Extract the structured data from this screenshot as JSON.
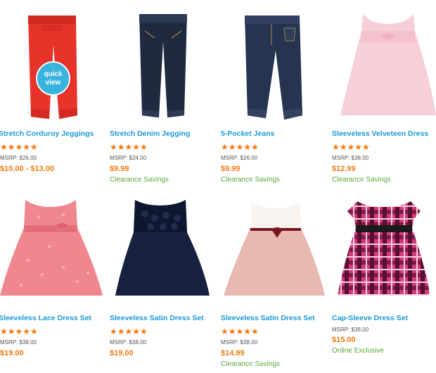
{
  "colors": {
    "link": "#1a9ad6",
    "price": "#f07a10",
    "note": "#59a83a",
    "stars": "#f07a10"
  },
  "quick_view": {
    "line1": "quick",
    "line2": "view"
  },
  "products": [
    {
      "title": "Stretch Corduroy Jeggings",
      "rating": 4.5,
      "stars": "★★★★★",
      "msrp": "MSRP: $26.00",
      "price": "$10.00 - $13.00",
      "note": "",
      "image": "red-jeggings"
    },
    {
      "title": "Stretch Denim Jegging",
      "rating": 5,
      "stars": "★★★★★",
      "msrp": "MSRP: $24.00",
      "price": "$9.99",
      "note": "Clearance Savings",
      "image": "denim-jegging"
    },
    {
      "title": "5-Pocket Jeans",
      "rating": 4.5,
      "stars": "★★★★★",
      "msrp": "MSRP: $26.00",
      "price": "$9.99",
      "note": "Clearance Savings",
      "image": "jeans"
    },
    {
      "title": "Sleeveless Velveteen Dress",
      "rating": 5,
      "stars": "★★★★★",
      "msrp": "MSRP: $38.00",
      "price": "$12.99",
      "note": "Clearance Savings",
      "image": "pink-velveteen-dress"
    },
    {
      "title": "Sleeveless Lace Dress Set",
      "rating": 5,
      "stars": "★★★★★",
      "msrp": "MSRP: $38.00",
      "price": "$19.00",
      "note": "",
      "image": "pink-lace-dress"
    },
    {
      "title": "Sleeveless Satin Dress Set",
      "rating": 5,
      "stars": "★★★★★",
      "msrp": "MSRP: $38.00",
      "price": "$19.00",
      "note": "",
      "image": "navy-satin-dress"
    },
    {
      "title": "Sleeveless Satin Dress Set",
      "rating": 5,
      "stars": "★★★★★",
      "msrp": "MSRP: $38.00",
      "price": "$14.99",
      "note": "Clearance Savings",
      "image": "blush-satin-dress"
    },
    {
      "title": "Cap-Sleeve Dress Set",
      "rating": null,
      "stars": "",
      "msrp": "MSRP: $38.00",
      "price": "$15.00",
      "note": "Online Exclusive",
      "image": "plaid-dress"
    }
  ]
}
